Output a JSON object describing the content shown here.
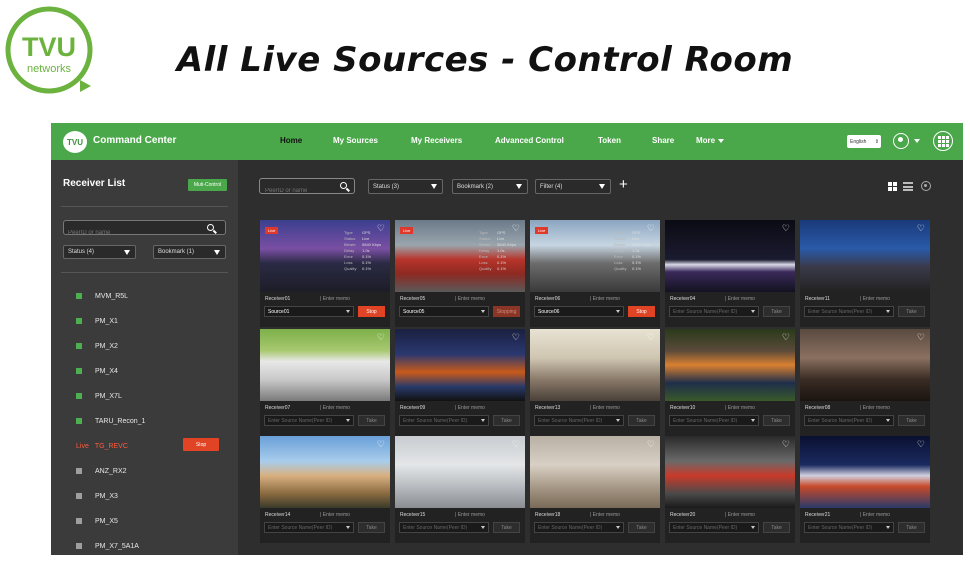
{
  "slide": {
    "logo": {
      "line1": "TVU",
      "line2": "networks",
      "color": "#6bb33e"
    },
    "title": "All Live Sources - Control Room"
  },
  "app": {
    "brand": "Command Center",
    "logo_text": "TVU",
    "accent": "#4aa84a",
    "nav": [
      {
        "label": "Home",
        "active": true
      },
      {
        "label": "My Sources"
      },
      {
        "label": "My Receivers"
      },
      {
        "label": "Advanced Control"
      },
      {
        "label": "Token"
      },
      {
        "label": "Share"
      },
      {
        "label": "More"
      }
    ],
    "language": "English",
    "icons": [
      "user-icon",
      "apps-grid-icon"
    ]
  },
  "sidebar": {
    "title": "Receiver List",
    "multi_control_label": "Muti-Control",
    "search_placeholder": "PeerID or name",
    "status_filter": "Status (4)",
    "bookmark_filter": "Bookmark (1)",
    "stop_label": "Stop",
    "receivers": [
      {
        "name": "MVM_R5L",
        "state": "online"
      },
      {
        "name": "PM_X1",
        "state": "online"
      },
      {
        "name": "PM_X2",
        "state": "online"
      },
      {
        "name": "PM_X4",
        "state": "online"
      },
      {
        "name": "PM_X7L",
        "state": "online"
      },
      {
        "name": "TARU_Recon_1",
        "state": "online"
      },
      {
        "name": "TG_REVC",
        "state": "live",
        "prefix": "Live"
      },
      {
        "name": "ANZ_RX2",
        "state": "offline"
      },
      {
        "name": "PM_X3",
        "state": "offline"
      },
      {
        "name": "PM_X5",
        "state": "offline"
      },
      {
        "name": "PM_X7_5A1A",
        "state": "offline"
      }
    ],
    "state_colors": {
      "online": "#4caf50",
      "offline": "#9e9e9e",
      "live": "#ff5a3c"
    }
  },
  "main": {
    "search_placeholder": "PeerID or name",
    "status_filter": "Status (3)",
    "bookmark_filter": "Bookmark (2)",
    "filter": "Filter (4)",
    "add_icon": "plus-icon",
    "view_icons": [
      "grid-view-icon",
      "list-view-icon",
      "settings-icon"
    ],
    "memo_placeholder": "Enter memo",
    "memo_placeholder_alt": "Enter memo",
    "source_placeholder": "Enter Source Name(Peer ID)",
    "stats_labels": {
      "type": "Type",
      "status": "Status",
      "bitrate": "Bitrate",
      "delay": "Delay",
      "error": "Error",
      "loss": "Loss",
      "quality": "Quality"
    },
    "cards": [
      {
        "receiver": "Receiver01",
        "live": true,
        "live_label": "Live",
        "source": "Source01",
        "action": "Stop",
        "stats": {
          "type": "GPS",
          "status": "Live",
          "bitrate": "5840 Kbps",
          "delay": "1.0s",
          "error": "0.1%",
          "loss": "0.1%",
          "quality": "0.1%"
        },
        "thumb": "news-studio"
      },
      {
        "receiver": "Receiver05",
        "live": true,
        "live_label": "Live",
        "source": "Source05",
        "action": "Stopping",
        "stats": {
          "type": "GPS",
          "status": "Live",
          "bitrate": "5840 Kbps",
          "delay": "1.0s",
          "error": "0.1%",
          "loss": "0.1%",
          "quality": "0.1%"
        },
        "thumb": "fire-truck"
      },
      {
        "receiver": "Receiver06",
        "live": true,
        "live_label": "Live",
        "source": "Source06",
        "action": "Stop",
        "stats": {
          "type": "GPS",
          "status": "Live",
          "bitrate": "5840 Kbps",
          "delay": "1.0s",
          "error": "0.1%",
          "loss": "0.1%",
          "quality": "0.1%"
        },
        "thumb": "interview"
      },
      {
        "receiver": "Receiver04",
        "action": "Take",
        "thumb": "fencing"
      },
      {
        "receiver": "Receiver11",
        "action": "Take",
        "thumb": "press-event"
      },
      {
        "receiver": "Receiver07",
        "action": "Take",
        "thumb": "race-car"
      },
      {
        "receiver": "Receiver09",
        "action": "Take",
        "thumb": "reporter"
      },
      {
        "receiver": "Receiver13",
        "action": "Take",
        "thumb": "handshake"
      },
      {
        "receiver": "Receiver10",
        "action": "Take",
        "thumb": "football"
      },
      {
        "receiver": "Receiver08",
        "action": "Take",
        "thumb": "crowd"
      },
      {
        "receiver": "Receiver14",
        "action": "Take",
        "thumb": "street-interview"
      },
      {
        "receiver": "Receiver15",
        "action": "Take",
        "thumb": "snowstorm"
      },
      {
        "receiver": "Receiver18",
        "action": "Take",
        "thumb": "motocross"
      },
      {
        "receiver": "Receiver20",
        "action": "Take",
        "thumb": "boxing"
      },
      {
        "receiver": "Receiver21",
        "action": "Take",
        "thumb": "stadium"
      }
    ]
  }
}
